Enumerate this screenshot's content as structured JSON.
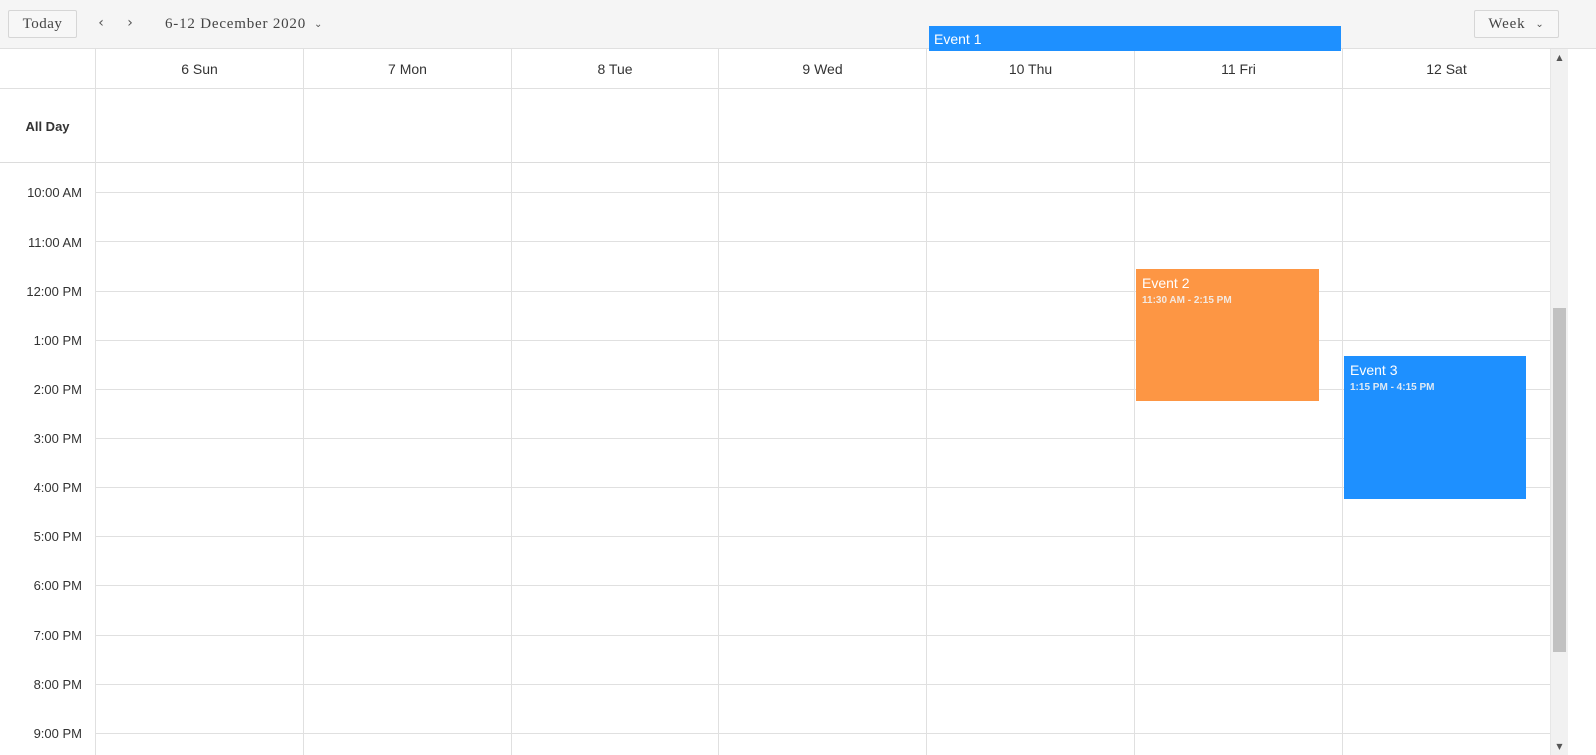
{
  "toolbar": {
    "today_label": "Today",
    "prev_icon": "‹",
    "next_icon": "›",
    "date_range": "6-12 December 2020",
    "dropdown_icon": "⌄",
    "view_label": "Week"
  },
  "days": [
    {
      "label": "6 Sun"
    },
    {
      "label": "7 Mon"
    },
    {
      "label": "8 Tue"
    },
    {
      "label": "9 Wed"
    },
    {
      "label": "10 Thu"
    },
    {
      "label": "11 Fri"
    },
    {
      "label": "12 Sat"
    }
  ],
  "allday": {
    "label": "All Day",
    "events": [
      {
        "title": "Event 1",
        "color": "#1e90ff"
      }
    ]
  },
  "time_labels": [
    "10:00 AM",
    "11:00 AM",
    "12:00 PM",
    "1:00 PM",
    "2:00 PM",
    "3:00 PM",
    "4:00 PM",
    "5:00 PM",
    "6:00 PM",
    "7:00 PM",
    "8:00 PM",
    "9:00 PM"
  ],
  "events": [
    {
      "title": "Event 2",
      "time": "11:30 AM - 2:15 PM",
      "color": "#fd9644"
    },
    {
      "title": "Event 3",
      "time": "1:15 PM - 4:15 PM",
      "color": "#1e90ff"
    }
  ],
  "scrollbar": {
    "up_icon": "▲",
    "down_icon": "▼"
  }
}
